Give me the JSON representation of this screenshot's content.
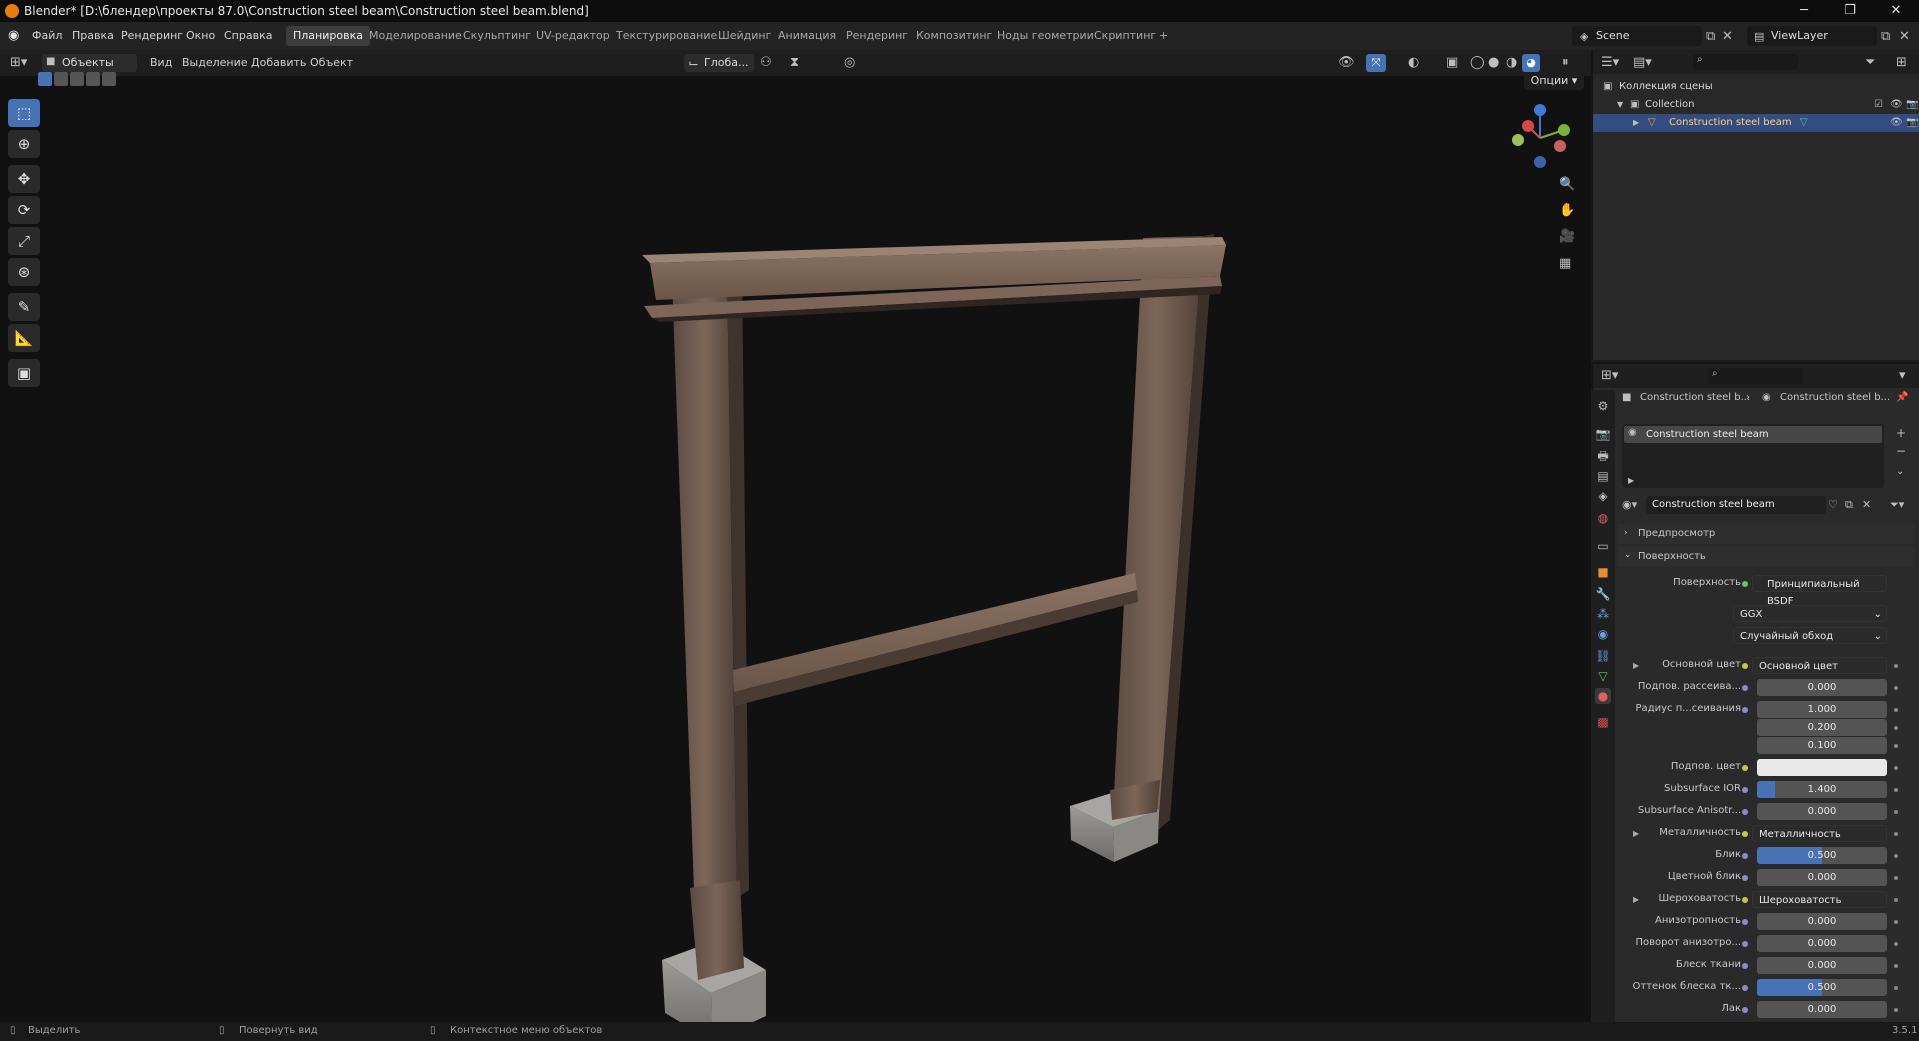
{
  "window": {
    "title": "Blender* [D:\\блендер\\проекты 87.0\\Construction steel beam\\Construction steel beam.blend]",
    "minimize": "─",
    "maximize": "❐",
    "close": "✕"
  },
  "menus": [
    "Файл",
    "Правка",
    "Рендеринг",
    "Окно",
    "Справка"
  ],
  "workspaces": [
    "Планировка",
    "Моделирование",
    "Скульптинг",
    "UV-редактор",
    "Текстурирование",
    "Шейдинг",
    "Анимация",
    "Рендеринг",
    "Композитинг",
    "Ноды геометрии",
    "Скриптинг",
    "+"
  ],
  "active_workspace": "Планировка",
  "scene": "Scene",
  "view_layer": "ViewLayer",
  "viewport_header": {
    "mode": "Объекты",
    "menus": [
      "Вид",
      "Выделение",
      "Добавить",
      "Объект"
    ],
    "transform": "Глоба...",
    "options": "Опции"
  },
  "outliner": {
    "root": "Коллекция сцены",
    "collection": "Collection",
    "object": "Construction steel beam"
  },
  "properties": {
    "breadcrumb": [
      "Construction steel b...",
      "Construction steel b..."
    ],
    "slot": "Construction steel beam",
    "material": "Construction steel beam",
    "sections": {
      "preview": "Предпросмотр",
      "surface": "Поверхность"
    },
    "surface_label": "Поверхность",
    "surface_value": "Принципиальный BSDF",
    "distribution": "GGX",
    "subsurface_method": "Случайный обход",
    "rows": [
      {
        "label": "Основной цвет",
        "value": "Основной цвет",
        "type": "link"
      },
      {
        "label": "Подпов. рассеива...",
        "value": "0.000",
        "type": "num"
      },
      {
        "label": "Радиус п...сеивания",
        "value": "1.000",
        "type": "num"
      },
      {
        "label": "",
        "value": "0.200",
        "type": "num"
      },
      {
        "label": "",
        "value": "0.100",
        "type": "num"
      },
      {
        "label": "Подпов. цвет",
        "value": "",
        "type": "color"
      },
      {
        "label": "Subsurface IOR",
        "value": "1.400",
        "type": "num14"
      },
      {
        "label": "Subsurface Anisotr...",
        "value": "0.000",
        "type": "num"
      },
      {
        "label": "Металличность",
        "value": "Металличность",
        "type": "link"
      },
      {
        "label": "Блик",
        "value": "0.500",
        "type": "num50"
      },
      {
        "label": "Цветной блик",
        "value": "0.000",
        "type": "num"
      },
      {
        "label": "Шероховатость",
        "value": "Шероховатость",
        "type": "link"
      },
      {
        "label": "Анизотропность",
        "value": "0.000",
        "type": "num"
      },
      {
        "label": "Поворот анизотро...",
        "value": "0.000",
        "type": "num"
      },
      {
        "label": "Блеск ткани",
        "value": "0.000",
        "type": "num"
      },
      {
        "label": "Оттенок блеска тк...",
        "value": "0.500",
        "type": "num50"
      },
      {
        "label": "Лак",
        "value": "0.000",
        "type": "num"
      }
    ]
  },
  "status": {
    "select": "Выделить",
    "rotate": "Повернуть вид",
    "context": "Контекстное меню объектов",
    "version": "3.5.1"
  },
  "colors": {
    "accent": "#4772b3",
    "selected_row": "#334d80",
    "object_text": "#ffd27a"
  }
}
